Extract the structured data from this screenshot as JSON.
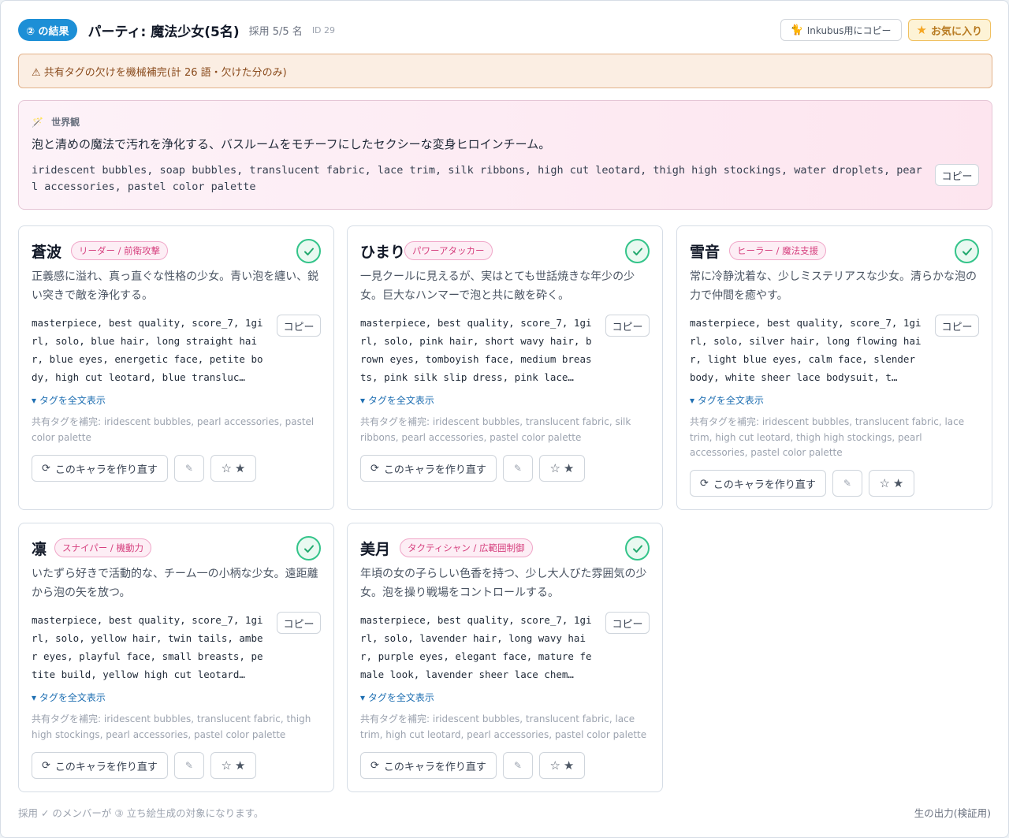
{
  "header": {
    "step_badge": "② の結果",
    "party_title": "パーティ: 魔法少女(5名)",
    "adopt_label": "採用 5/5 名",
    "id_label": "ID 29",
    "inkubus_button": "Inkubus用にコピー",
    "favorite_button": "お気に入り"
  },
  "warning": {
    "text": "⚠ 共有タグの欠けを機械補完(計 26 語・欠けた分のみ)"
  },
  "world": {
    "label": "世界観",
    "description": "泡と清めの魔法で汚れを浄化する、バスルームをモチーフにしたセクシーな変身ヒロインチーム。",
    "tags": "iridescent bubbles, soap bubbles, translucent fabric, lace trim, silk ribbons, high cut leotard, thigh high stockings, water droplets, pearl accessories, pastel color palette",
    "copy_label": "コピー"
  },
  "characters": [
    {
      "name": "蒼波",
      "role": "リーダー / 前衛攻撃",
      "description": "正義感に溢れ、真っ直ぐな性格の少女。青い泡を纏い、鋭い突きで敵を浄化する。",
      "tags": "masterpiece, best quality, score_7, 1girl, solo, blue hair, long straight hair, blue eyes, energetic face, petite body, high cut leotard, blue transluc…",
      "copy_label": "コピー",
      "expand_label": "▾ タグを全文表示",
      "fill_note": "共有タグを補完: iridescent bubbles, pearl accessories, pastel color palette",
      "regen_label": "このキャラを作り直す",
      "adopted": true
    },
    {
      "name": "ひまり",
      "role": "パワーアタッカー",
      "description": "一見クールに見えるが、実はとても世話焼きな年少の少女。巨大なハンマーで泡と共に敵を砕く。",
      "tags": "masterpiece, best quality, score_7, 1girl, solo, pink hair, short wavy hair, brown eyes, tomboyish face, medium breasts, pink silk slip dress, pink lace…",
      "copy_label": "コピー",
      "expand_label": "▾ タグを全文表示",
      "fill_note": "共有タグを補完: iridescent bubbles, translucent fabric, silk ribbons, pearl accessories, pastel color palette",
      "regen_label": "このキャラを作り直す",
      "adopted": true
    },
    {
      "name": "雪音",
      "role": "ヒーラー / 魔法支援",
      "description": "常に冷静沈着な、少しミステリアスな少女。清らかな泡の力で仲間を癒やす。",
      "tags": "masterpiece, best quality, score_7, 1girl, solo, silver hair, long flowing hair, light blue eyes, calm face, slender body, white sheer lace bodysuit, t…",
      "copy_label": "コピー",
      "expand_label": "▾ タグを全文表示",
      "fill_note": "共有タグを補完: iridescent bubbles, translucent fabric, lace trim, high cut leotard, thigh high stockings, pearl accessories, pastel color palette",
      "regen_label": "このキャラを作り直す",
      "adopted": true
    },
    {
      "name": "凛",
      "role": "スナイパー / 機動力",
      "description": "いたずら好きで活動的な、チーム一の小柄な少女。遠距離から泡の矢を放つ。",
      "tags": "masterpiece, best quality, score_7, 1girl, solo, yellow hair, twin tails, amber eyes, playful face, small breasts, petite build, yellow high cut leotard…",
      "copy_label": "コピー",
      "expand_label": "▾ タグを全文表示",
      "fill_note": "共有タグを補完: iridescent bubbles, translucent fabric, thigh high stockings, pearl accessories, pastel color palette",
      "regen_label": "このキャラを作り直す",
      "adopted": true
    },
    {
      "name": "美月",
      "role": "タクティシャン / 広範囲制御",
      "description": "年頃の女の子らしい色香を持つ、少し大人びた雰囲気の少女。泡を操り戦場をコントロールする。",
      "tags": "masterpiece, best quality, score_7, 1girl, solo, lavender hair, long wavy hair, purple eyes, elegant face, mature female look, lavender sheer lace chem…",
      "copy_label": "コピー",
      "expand_label": "▾ タグを全文表示",
      "fill_note": "共有タグを補完: iridescent bubbles, translucent fabric, lace trim, high cut leotard, pearl accessories, pastel color palette",
      "regen_label": "このキャラを作り直す",
      "adopted": true
    }
  ],
  "footer": {
    "note": "採用 ✓ のメンバーが ③ 立ち絵生成の対象になります。",
    "raw_output": "生の出力(検証用)"
  },
  "colors": {
    "accent": "#1d8fd6",
    "adopted_check": "#34c48a",
    "role_pink": "#d6417f",
    "warning_bg": "#fbeee3"
  }
}
